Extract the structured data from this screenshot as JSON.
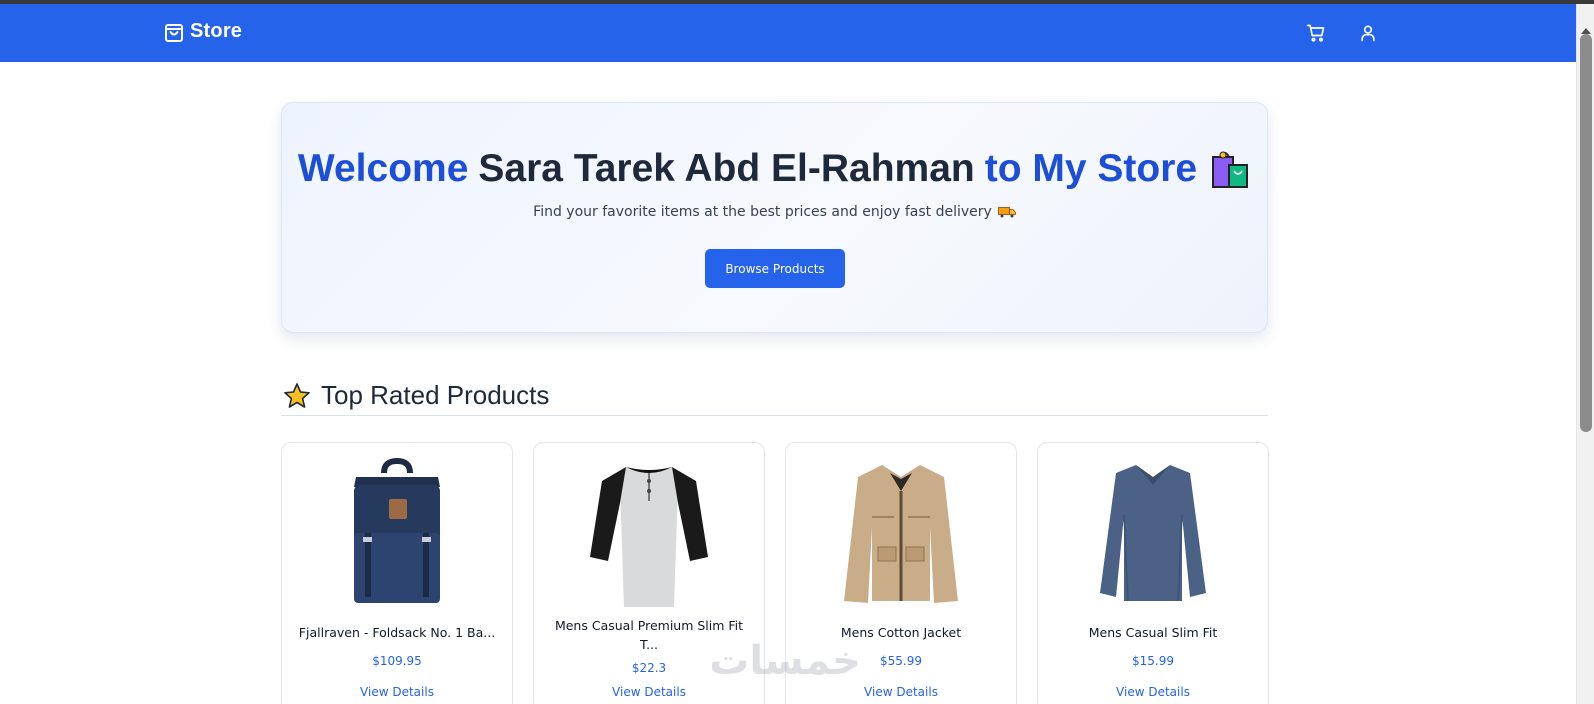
{
  "navbar": {
    "brand": "Store",
    "cart_icon": "cart-icon",
    "user_icon": "user-icon",
    "background": "#2563eb"
  },
  "hero": {
    "title_part1": "Welcome",
    "title_name": "Sara Tarek Abd El-Rahman",
    "title_part2": "to My Store",
    "title_emoji_icon": "shopping-bags-icon",
    "subtitle": "Find your favorite items at the best prices and enjoy fast delivery",
    "subtitle_icon": "delivery-truck-icon",
    "button_label": "Browse Products",
    "accent_color": "#1d4ed8"
  },
  "top_rated": {
    "title": "Top Rated Products",
    "icon": "star-icon",
    "products": [
      {
        "title": "Fjallraven - Foldsack No. 1 Ba...",
        "price": "$109.95",
        "link": "View Details",
        "image_icon": "backpack-image"
      },
      {
        "title": "Mens Casual Premium Slim Fit T...",
        "price": "$22.3",
        "link": "View Details",
        "image_icon": "raglan-tshirt-image"
      },
      {
        "title": "Mens Cotton Jacket",
        "price": "$55.99",
        "link": "View Details",
        "image_icon": "cotton-jacket-image"
      },
      {
        "title": "Mens Casual Slim Fit",
        "price": "$15.99",
        "link": "View Details",
        "image_icon": "slim-fit-shirt-image"
      }
    ]
  },
  "watermark_text": "خمسات"
}
